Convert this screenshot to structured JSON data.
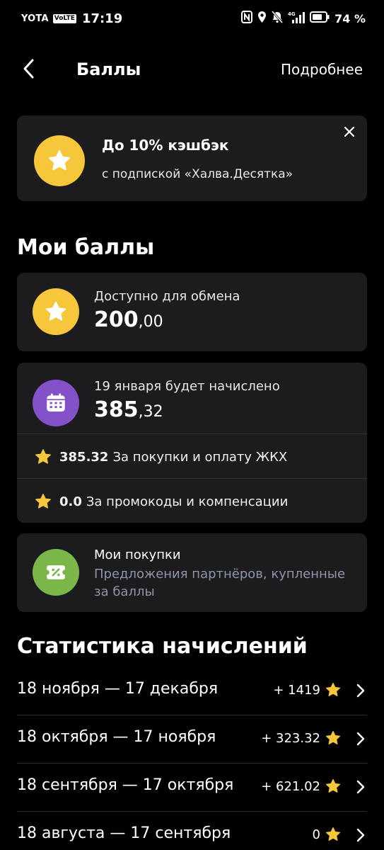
{
  "status_bar": {
    "carrier": "YOTA",
    "volte": "VoLTE",
    "time": "17:19",
    "network": "4G",
    "battery": "74 %",
    "icons": [
      "nfc-icon",
      "location-icon",
      "mute-bell-icon",
      "signal-icon",
      "battery-icon"
    ]
  },
  "header": {
    "back_icon": "chevron-left-icon",
    "title": "Баллы",
    "details": "Подробнее"
  },
  "promo": {
    "icon": "star-coin-icon",
    "title": "До 10% кэшбэк",
    "subtitle": "с подпиской «Халва.Десятка»",
    "close_icon": "close-icon"
  },
  "my_points": {
    "section_title": "Мои баллы",
    "available": {
      "icon": "star-coin-icon",
      "label": "Доступно для обмена",
      "amount_int": "200",
      "amount_frac": ",00"
    },
    "accrual": {
      "icon": "calendar-icon",
      "label": "19 января будет начислено",
      "amount_int": "385",
      "amount_frac": ",32",
      "items": [
        {
          "value": "385.32",
          "text": "За покупки и оплату ЖКХ"
        },
        {
          "value": "0.0",
          "text": "За промокоды и компенсации"
        }
      ]
    },
    "purchases": {
      "icon": "discount-ticket-icon",
      "title": "Мои покупки",
      "description": "Предложения партнёров, купленные за баллы"
    }
  },
  "stats": {
    "section_title": "Статистика начислений",
    "rows": [
      {
        "period": "18 ноября — 17 декабря",
        "value": "+ 1419"
      },
      {
        "period": "18 октября — 17 ноября",
        "value": "+ 323.32"
      },
      {
        "period": "18 сентября — 17 октября",
        "value": "+ 621.02"
      },
      {
        "period": "18 августа — 17 сентября",
        "value": "0"
      }
    ]
  },
  "colors": {
    "background": "#000000",
    "card": "#1c1c1e",
    "star_yellow": "#f7c73b",
    "calendar_purple": "#8452c8",
    "ticket_green": "#7ab648",
    "muted_text": "#8e95a6"
  }
}
